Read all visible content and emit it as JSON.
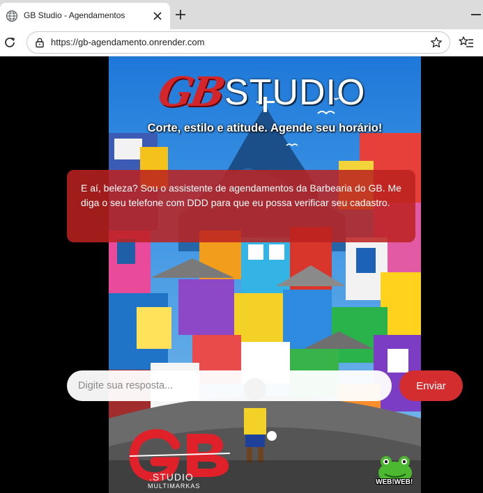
{
  "browser": {
    "tab_title": "GB Studio - Agendamentos",
    "url": "https://gb-agendamento.onrender.com"
  },
  "hero": {
    "logo_gb": "GB",
    "logo_studio": "STUDIO",
    "tagline": "Corte, estilo e atitude. Agende seu horário!"
  },
  "chat": {
    "bot_message": "E aí, beleza? Sou o assistente de agendamentos da Barbearia do GB. Me diga o seu telefone com DDD para que eu possa verificar seu cadastro.",
    "input_placeholder": "Digite sua resposta...",
    "send_label": "Enviar"
  },
  "footer": {
    "logo_studio": ".STUDIO",
    "logo_multimarkas": "MULTIMARKAS",
    "badge_text": "WEB!WEB!"
  },
  "colors": {
    "accent_red": "#d32d2f",
    "bubble_red": "#bc2220"
  }
}
